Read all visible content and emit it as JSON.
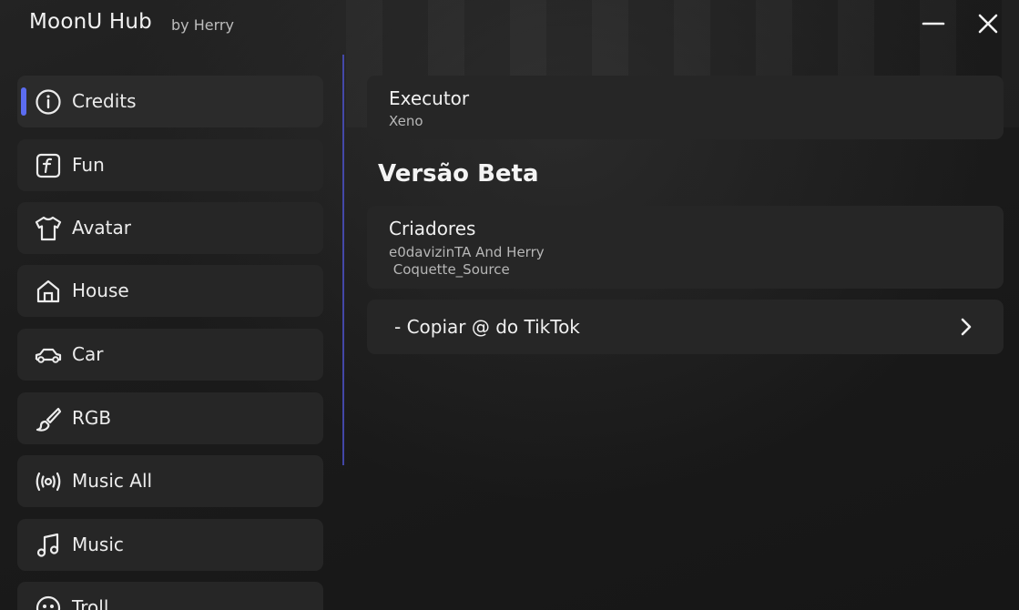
{
  "window": {
    "title": "MoonU Hub",
    "subtitle": "by Herry"
  },
  "sidebar": {
    "items": [
      {
        "label": "Credits",
        "icon": "info-icon",
        "active": true
      },
      {
        "label": "Fun",
        "icon": "f-icon"
      },
      {
        "label": "Avatar",
        "icon": "shirt-icon"
      },
      {
        "label": "House",
        "icon": "house-icon"
      },
      {
        "label": "Car",
        "icon": "car-icon"
      },
      {
        "label": "RGB",
        "icon": "brush-icon"
      },
      {
        "label": "Music All",
        "icon": "broadcast-icon"
      },
      {
        "label": "Music",
        "icon": "music-note-icon"
      },
      {
        "label": "Troll",
        "icon": "face-icon"
      }
    ],
    "accent_color": "#5b6cf0"
  },
  "main": {
    "executor": {
      "title": "Executor",
      "value": "Xeno"
    },
    "section_heading": "Versão Beta",
    "creators": {
      "title": "Criadores",
      "line1": "e0davizinTA And Herry",
      "line2": " Coquette_Source"
    },
    "copy_button": {
      "label": "- Copiar @ do TikTok",
      "icon": "chevron-right-icon"
    }
  }
}
